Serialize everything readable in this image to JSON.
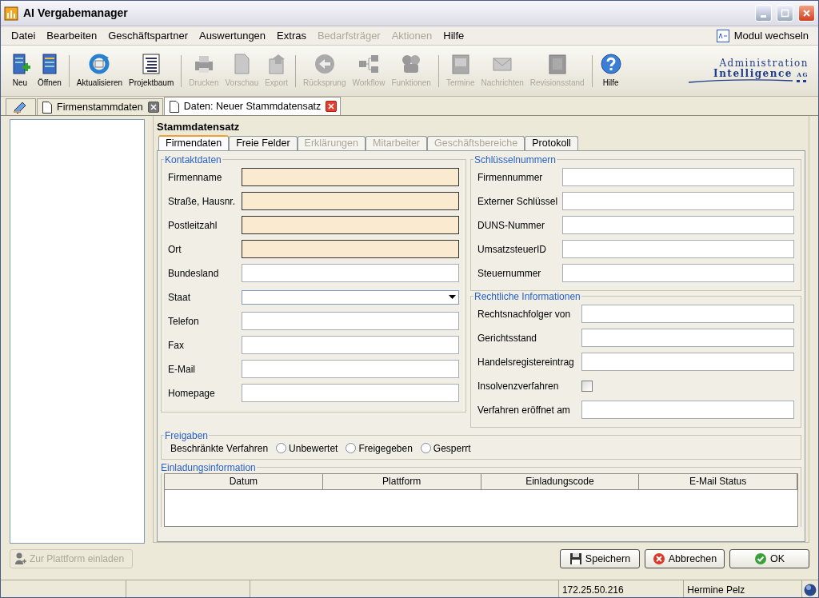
{
  "window": {
    "title": "AI Vergabemanager"
  },
  "menu": [
    {
      "label": "Datei",
      "disabled": false
    },
    {
      "label": "Bearbeiten",
      "disabled": false
    },
    {
      "label": "Geschäftspartner",
      "disabled": false
    },
    {
      "label": "Auswertungen",
      "disabled": false
    },
    {
      "label": "Extras",
      "disabled": false
    },
    {
      "label": "Bedarfsträger",
      "disabled": true
    },
    {
      "label": "Aktionen",
      "disabled": true
    },
    {
      "label": "Hilfe",
      "disabled": false
    }
  ],
  "module_switch": {
    "label": "Modul wechseln"
  },
  "toolbar": [
    [
      {
        "label": "Neu",
        "disabled": false
      },
      {
        "label": "Öffnen",
        "disabled": false
      }
    ],
    [
      {
        "label": "Aktualisieren",
        "disabled": false
      },
      {
        "label": "Projektbaum",
        "disabled": false
      }
    ],
    [
      {
        "label": "Drucken",
        "disabled": true
      },
      {
        "label": "Vorschau",
        "disabled": true
      },
      {
        "label": "Export",
        "disabled": true
      }
    ],
    [
      {
        "label": "Rücksprung",
        "disabled": true
      },
      {
        "label": "Workflow",
        "disabled": true
      },
      {
        "label": "Funktionen",
        "disabled": true
      }
    ],
    [
      {
        "label": "Termine",
        "disabled": true
      },
      {
        "label": "Nachrichten",
        "disabled": true
      },
      {
        "label": "Revisionsstand",
        "disabled": true
      }
    ],
    [
      {
        "label": "Hilfe",
        "disabled": false
      }
    ]
  ],
  "logo": {
    "line1": "Administration",
    "line2": "Intelligence",
    "suffix": "AG"
  },
  "doc_tabs": [
    {
      "label": "Firmenstammdaten",
      "selected": false,
      "close_active": false
    },
    {
      "label": "Daten: Neuer Stammdatensatz",
      "selected": true,
      "close_active": true
    }
  ],
  "sidebar": {
    "invite_button": {
      "label": "Zur Plattform einladen",
      "disabled": true
    }
  },
  "record": {
    "title": "Stammdatensatz",
    "tabs": [
      {
        "label": "Firmendaten",
        "selected": true,
        "disabled": false
      },
      {
        "label": "Freie Felder",
        "selected": false,
        "disabled": false
      },
      {
        "label": "Erklärungen",
        "selected": false,
        "disabled": true
      },
      {
        "label": "Mitarbeiter",
        "selected": false,
        "disabled": true
      },
      {
        "label": "Geschäftsbereiche",
        "selected": false,
        "disabled": true
      },
      {
        "label": "Protokoll",
        "selected": false,
        "disabled": false
      }
    ],
    "contact": {
      "title": "Kontaktdaten",
      "fields": [
        {
          "label": "Firmenname",
          "kind": "text",
          "required": true
        },
        {
          "label": "Straße, Hausnr.",
          "kind": "text",
          "required": true
        },
        {
          "label": "Postleitzahl",
          "kind": "text",
          "required": true
        },
        {
          "label": "Ort",
          "kind": "text",
          "required": true
        },
        {
          "label": "Bundesland",
          "kind": "text",
          "required": false
        },
        {
          "label": "Staat",
          "kind": "select",
          "required": false
        },
        {
          "label": "Telefon",
          "kind": "text",
          "required": false
        },
        {
          "label": "Fax",
          "kind": "text",
          "required": false
        },
        {
          "label": "E-Mail",
          "kind": "text",
          "required": false
        },
        {
          "label": "Homepage",
          "kind": "text",
          "required": false
        }
      ]
    },
    "keys": {
      "title": "Schlüsselnummern",
      "fields": [
        {
          "label": "Firmennummer",
          "kind": "text"
        },
        {
          "label": "Externer Schlüssel",
          "kind": "text"
        },
        {
          "label": "DUNS-Nummer",
          "kind": "text"
        },
        {
          "label": "UmsatzsteuerID",
          "kind": "text"
        },
        {
          "label": "Steuernummer",
          "kind": "text"
        }
      ]
    },
    "legal": {
      "title": "Rechtliche Informationen",
      "fields": [
        {
          "label": "Rechtsnachfolger von",
          "kind": "text"
        },
        {
          "label": "Gerichtsstand",
          "kind": "text"
        },
        {
          "label": "Handelsregistereintrag",
          "kind": "text"
        },
        {
          "label": "Insolvenzverfahren",
          "kind": "checkbox",
          "checked": false
        },
        {
          "label": "Verfahren eröffnet am",
          "kind": "text"
        }
      ]
    },
    "release": {
      "title": "Freigaben",
      "label": "Beschränkte Verfahren",
      "options": [
        {
          "label": "Unbewertet",
          "selected": false
        },
        {
          "label": "Freigegeben",
          "selected": false
        },
        {
          "label": "Gesperrt",
          "selected": false
        }
      ]
    },
    "invitations": {
      "title": "Einladungsinformation",
      "columns": [
        "Datum",
        "Plattform",
        "Einladungscode",
        "E-Mail Status"
      ]
    }
  },
  "buttons": [
    {
      "label": "Speichern",
      "kind": "save"
    },
    {
      "label": "Abbrechen",
      "kind": "cancel"
    },
    {
      "label": "OK",
      "kind": "ok"
    }
  ],
  "status_bar": {
    "ip": "172.25.50.216",
    "user": "Hermine Pelz"
  }
}
